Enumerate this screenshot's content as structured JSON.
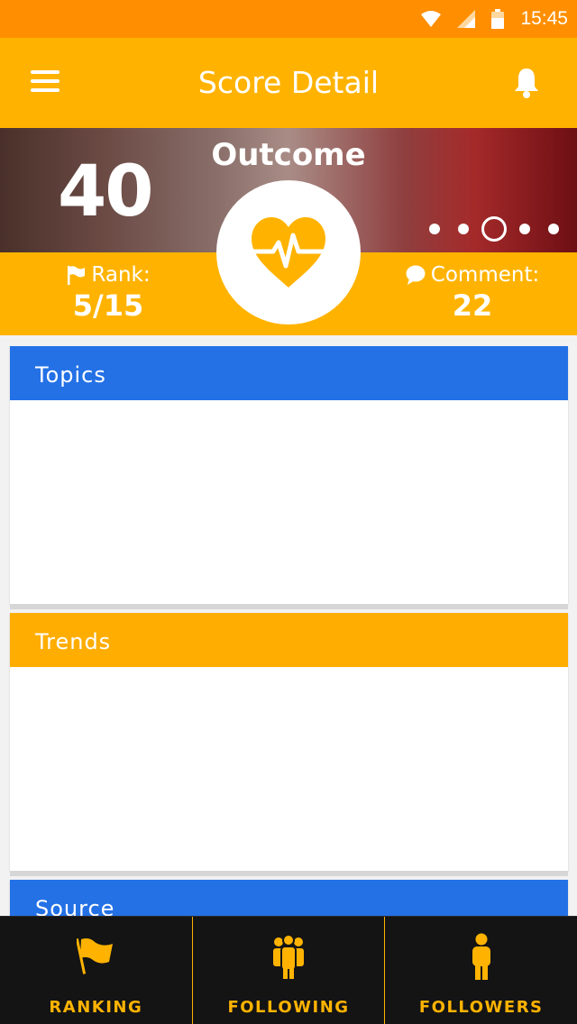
{
  "status_bar": {
    "time": "15:45",
    "icons": [
      "wifi-icon",
      "signal-icon",
      "battery-icon"
    ]
  },
  "app_bar": {
    "title": "Score Detail",
    "menu_icon": "hamburger-menu-icon",
    "notification_icon": "bell-icon"
  },
  "hero": {
    "score": "40",
    "category": "Outcome",
    "category_icon": "heart-pulse-icon",
    "carousel": {
      "dot_count": 5,
      "active_index": 2
    },
    "rank": {
      "label": "Rank:",
      "value": "5/15",
      "icon": "flag-icon"
    },
    "comment": {
      "label": "Comment:",
      "value": "22",
      "icon": "speech-bubble-icon"
    }
  },
  "sections": [
    {
      "title": "Topics",
      "color": "#2471e6"
    },
    {
      "title": "Trends",
      "color": "#ffad00"
    },
    {
      "title": "Source",
      "color": "#2471e6"
    }
  ],
  "bottom_nav": [
    {
      "label": "RANKING",
      "icon": "flag-icon"
    },
    {
      "label": "FOLLOWING",
      "icon": "group-icon"
    },
    {
      "label": "FOLLOWERS",
      "icon": "person-icon"
    }
  ],
  "colors": {
    "primary": "#ffb300",
    "status_bar": "#ff8f00",
    "accent_blue": "#2471e6",
    "nav_background": "#141414"
  }
}
